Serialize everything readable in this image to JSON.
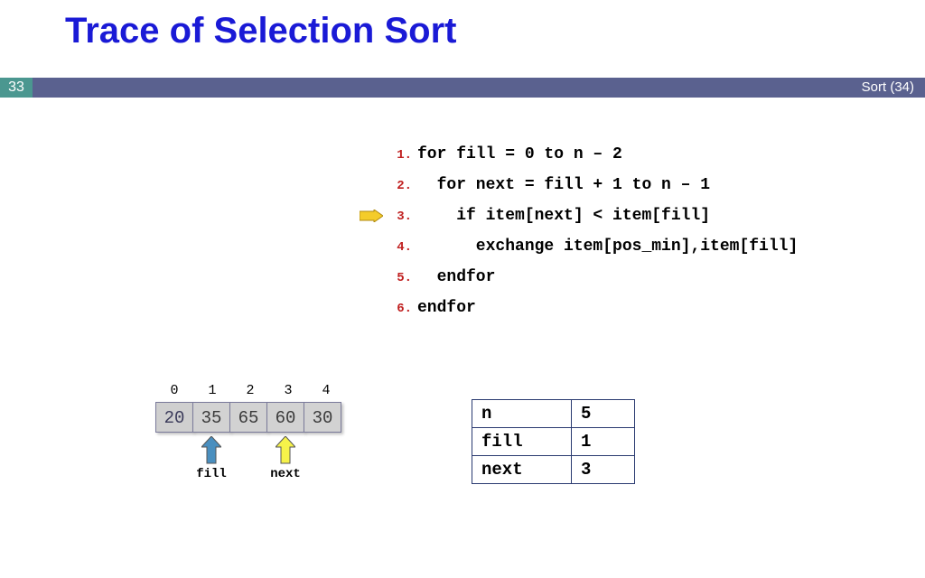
{
  "title": "Trace of Selection Sort",
  "bar": {
    "left": "33",
    "right": "Sort (34)"
  },
  "code": [
    {
      "n": "1.",
      "text": "for fill = 0 to n – 2",
      "indent": 0
    },
    {
      "n": "2.",
      "text": "for next = fill + 1 to n – 1",
      "indent": 1
    },
    {
      "n": "3.",
      "text": "if item[next] < item[fill]",
      "indent": 2
    },
    {
      "n": "4.",
      "text": "exchange item[pos_min],item[fill]",
      "indent": 3
    },
    {
      "n": "5.",
      "text": "endfor",
      "indent": 1
    },
    {
      "n": "6.",
      "text": "endfor",
      "indent": 0
    }
  ],
  "current_line_index": 2,
  "array": {
    "indices": [
      "0",
      "1",
      "2",
      "3",
      "4"
    ],
    "values": [
      "20",
      "35",
      "65",
      "60",
      "30"
    ],
    "sorted_count": 1
  },
  "arrows": {
    "fill": {
      "label": "fill",
      "index": 1,
      "color": "#4a8fbf"
    },
    "next": {
      "label": "next",
      "index": 3,
      "color": "#f6f24a"
    }
  },
  "vars": [
    {
      "k": "n",
      "v": "5"
    },
    {
      "k": "fill",
      "v": "1"
    },
    {
      "k": "next",
      "v": "3"
    }
  ],
  "chart_data": {
    "type": "table",
    "title": "Selection sort trace — array state and loop variables",
    "array_indices": [
      0,
      1,
      2,
      3,
      4
    ],
    "array_values": [
      20,
      35,
      65,
      60,
      30
    ],
    "variables": {
      "n": 5,
      "fill": 1,
      "next": 3
    },
    "current_pseudocode_line": 3
  }
}
